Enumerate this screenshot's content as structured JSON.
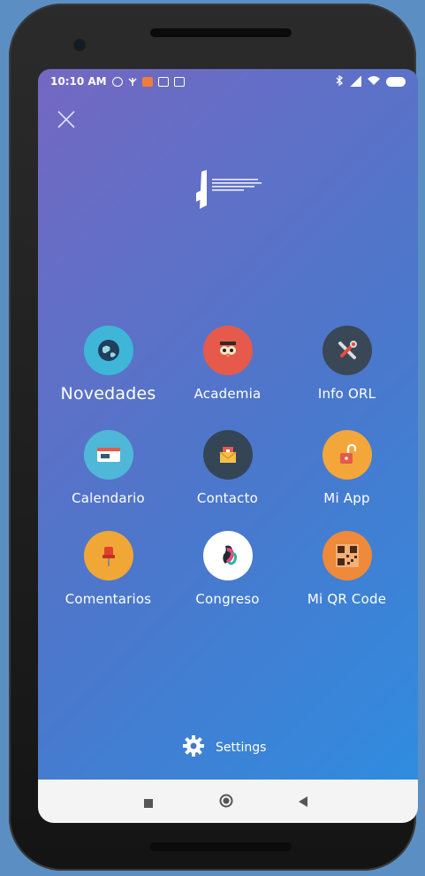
{
  "status_bar": {
    "time": "10:10 AM"
  },
  "menu": {
    "items": [
      {
        "label": "Novedades",
        "icon": "globe-icon",
        "color": "#3fb6d8"
      },
      {
        "label": "Academia",
        "icon": "owl-icon",
        "color": "#e55a4a"
      },
      {
        "label": "Info ORL",
        "icon": "tools-icon",
        "color": "#3a4756"
      },
      {
        "label": "Calendario",
        "icon": "calendar-icon",
        "color": "#4fb8d8"
      },
      {
        "label": "Contacto",
        "icon": "mail-icon",
        "color": "#344556"
      },
      {
        "label": "Mi App",
        "icon": "unlock-icon",
        "color": "#f3a73a"
      },
      {
        "label": "Comentarios",
        "icon": "pushpin-icon",
        "color": "#f1a736"
      },
      {
        "label": "Congreso",
        "icon": "flamingo-icon",
        "color": "#ffffff"
      },
      {
        "label": "Mi QR Code",
        "icon": "qr-code-icon",
        "color": "#ee8a3a"
      }
    ]
  },
  "settings": {
    "label": "Settings"
  },
  "colors": {
    "gradient_start": "#7468c2",
    "gradient_end": "#2d8ee2",
    "nav_bar": "#f4f4f4"
  }
}
